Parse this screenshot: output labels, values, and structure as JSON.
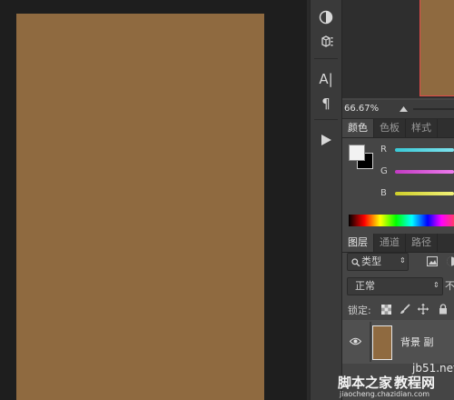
{
  "canvas": {
    "document_color": "#8f6a40"
  },
  "toolbar": {
    "icons": [
      "contrast-icon",
      "cube-icon",
      "type-icon",
      "paragraph-icon",
      "play-icon"
    ],
    "type_glyph": "A|",
    "paragraph_glyph": "¶"
  },
  "navigator": {
    "zoom": "66.67%"
  },
  "color_panel": {
    "tabs": [
      "颜色",
      "色板",
      "样式"
    ],
    "r_label": "R",
    "g_label": "G",
    "b_label": "B",
    "fg_color": "#f2f2f2",
    "bg_color": "#000000"
  },
  "layers_panel": {
    "tabs": [
      "图层",
      "通道",
      "路径"
    ],
    "filter_label": "类型",
    "blend_mode": "正常",
    "lock_label": "锁定:",
    "opacity_label_partial": "不",
    "layer_name_partial": "背景 副"
  },
  "watermark": {
    "line1": "jb51.net",
    "line2": "脚本之家",
    "line3": "教程网",
    "line4": "jiaocheng.chazidian.com"
  }
}
